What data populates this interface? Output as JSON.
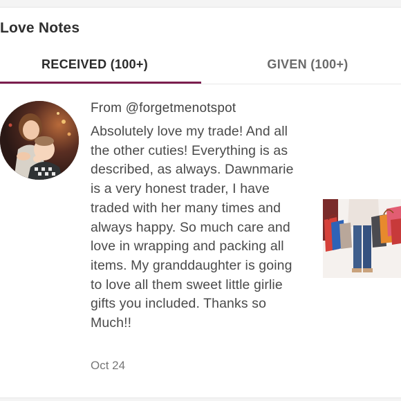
{
  "section": {
    "title": "Love Notes"
  },
  "tabs": [
    {
      "label": "RECEIVED (100+)",
      "active": true
    },
    {
      "label": "GIVEN (100+)",
      "active": false
    }
  ],
  "colors": {
    "accent": "#7b1e4e",
    "text": "#4a4a4a",
    "muted": "#777777"
  },
  "note": {
    "from": "From @forgetmenotspot",
    "text": "Absolutely love my trade! And all the other cuties! Everything is as described, as always. Dawnmarie is a very honest trader, I have traded with her many times and always happy. So much care and love in wrapping and packing all items. My granddaughter is going to love all them sweet little girlie gifts you included. Thanks so Much!!",
    "date": "Oct 24",
    "avatar": "user-avatar-photo",
    "listing_image": "shopping-bags-photo"
  }
}
